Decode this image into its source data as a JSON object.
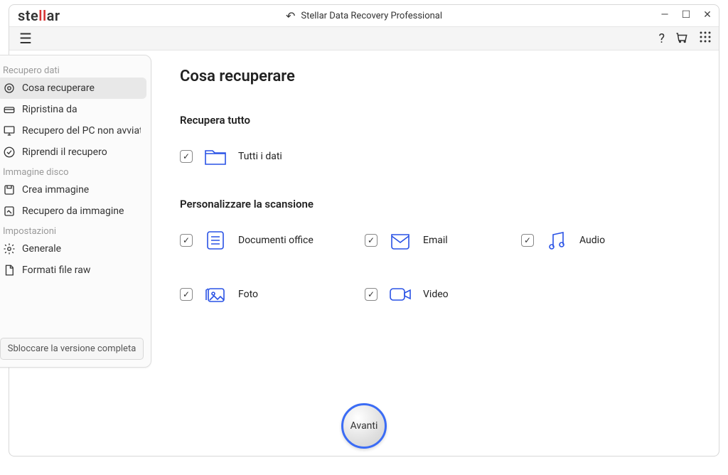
{
  "titlebar": {
    "app_title": "Stellar Data Recovery Professional",
    "logo_pre": "ste",
    "logo_mid": "ll",
    "logo_post": "ar"
  },
  "sidebar": {
    "sections": {
      "recovery": "Recupero dati",
      "disk_image": "Immagine disco",
      "settings": "Impostazioni"
    },
    "items": {
      "what_to_recover": "Cosa recuperare",
      "restore_from": "Ripristina da",
      "crashed_pc": "Recupero del PC non avviato",
      "resume_recovery": "Riprendi il recupero",
      "create_image": "Crea immagine",
      "recover_from_image": "Recupero da immagine",
      "general": "Generale",
      "raw_formats": "Formati file raw"
    },
    "unlock": "Sbloccare la versione completa"
  },
  "main": {
    "page_title": "Cosa recuperare",
    "recover_all_title": "Recupera tutto",
    "customize_title": "Personalizzare la scansione",
    "options": {
      "all_data": "Tutti i dati",
      "office": "Documenti office",
      "email": "Email",
      "audio": "Audio",
      "photo": "Foto",
      "video": "Video"
    },
    "next_button": "Avanti"
  }
}
